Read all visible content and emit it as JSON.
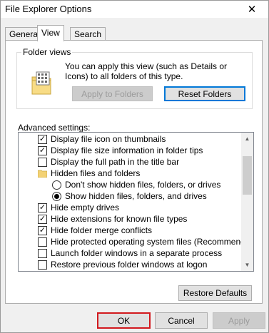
{
  "window": {
    "title": "File Explorer Options",
    "close_glyph": "✕"
  },
  "tabs": [
    {
      "label": "General",
      "active": false
    },
    {
      "label": "View",
      "active": true
    },
    {
      "label": "Search",
      "active": false
    }
  ],
  "folder_views": {
    "legend": "Folder views",
    "description": "You can apply this view (such as Details or Icons) to all folders of this type.",
    "apply_label": "Apply to Folders",
    "reset_label": "Reset Folders"
  },
  "advanced": {
    "label": "Advanced settings:",
    "items": [
      {
        "kind": "checkbox",
        "checked": true,
        "label": "Display file icon on thumbnails",
        "indent": 1
      },
      {
        "kind": "checkbox",
        "checked": true,
        "label": "Display file size information in folder tips",
        "indent": 1
      },
      {
        "kind": "checkbox",
        "checked": false,
        "label": "Display the full path in the title bar",
        "indent": 1
      },
      {
        "kind": "folder",
        "label": "Hidden files and folders",
        "indent": 1
      },
      {
        "kind": "radio",
        "checked": false,
        "label": "Don't show hidden files, folders, or drives",
        "indent": 2
      },
      {
        "kind": "radio",
        "checked": true,
        "label": "Show hidden files, folders, and drives",
        "indent": 2
      },
      {
        "kind": "checkbox",
        "checked": true,
        "label": "Hide empty drives",
        "indent": 1
      },
      {
        "kind": "checkbox",
        "checked": true,
        "label": "Hide extensions for known file types",
        "indent": 1
      },
      {
        "kind": "checkbox",
        "checked": true,
        "label": "Hide folder merge conflicts",
        "indent": 1
      },
      {
        "kind": "checkbox",
        "checked": false,
        "label": "Hide protected operating system files (Recommended)",
        "indent": 1
      },
      {
        "kind": "checkbox",
        "checked": false,
        "label": "Launch folder windows in a separate process",
        "indent": 1
      },
      {
        "kind": "checkbox",
        "checked": false,
        "label": "Restore previous folder windows at logon",
        "indent": 1
      }
    ],
    "restore_defaults_label": "Restore Defaults"
  },
  "footer": {
    "ok_label": "OK",
    "cancel_label": "Cancel",
    "apply_label": "Apply"
  },
  "colors": {
    "highlight_border": "#d2191e",
    "focus_blue": "#0078d7"
  }
}
